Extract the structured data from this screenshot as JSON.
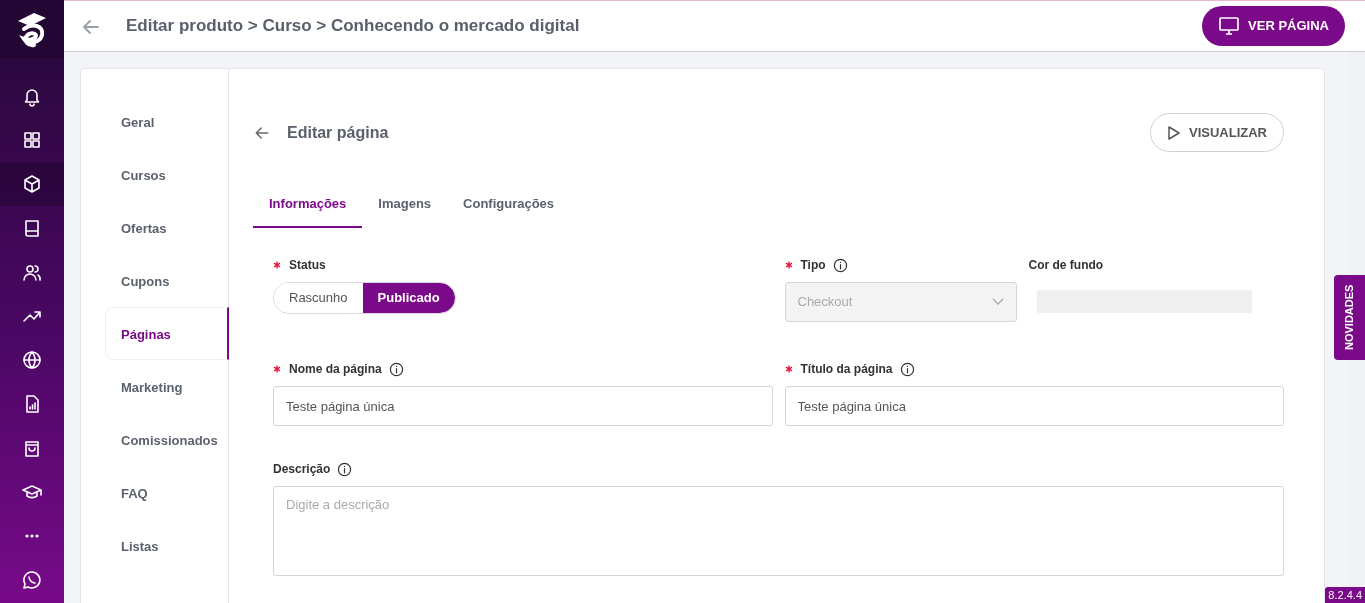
{
  "app_sidebar": {
    "items": [
      {
        "kind": "bell",
        "selected": false
      },
      {
        "kind": "grid",
        "selected": false
      },
      {
        "kind": "cube",
        "selected": true
      },
      {
        "kind": "book",
        "selected": false
      },
      {
        "kind": "users",
        "selected": false
      },
      {
        "kind": "trend",
        "selected": false
      },
      {
        "kind": "globe",
        "selected": false
      },
      {
        "kind": "report",
        "selected": false
      },
      {
        "kind": "bag",
        "selected": false
      },
      {
        "kind": "cap",
        "selected": false
      },
      {
        "kind": "dots",
        "selected": false
      },
      {
        "kind": "chat",
        "selected": false
      }
    ]
  },
  "header": {
    "breadcrumb": "Editar produto > Curso > Conhecendo o mercado digital",
    "button": "VER PÁGINA"
  },
  "product_nav": {
    "items": [
      {
        "label": "Geral",
        "selected": false
      },
      {
        "label": "Cursos",
        "selected": false
      },
      {
        "label": "Ofertas",
        "selected": false
      },
      {
        "label": "Cupons",
        "selected": false
      },
      {
        "label": "Páginas",
        "selected": true
      },
      {
        "label": "Marketing",
        "selected": false
      },
      {
        "label": "Comissionados",
        "selected": false
      },
      {
        "label": "FAQ",
        "selected": false
      },
      {
        "label": "Listas",
        "selected": false
      }
    ]
  },
  "page": {
    "title": "Editar página",
    "button": "VISUALIZAR"
  },
  "tabs": [
    {
      "label": "Informações",
      "selected": true
    },
    {
      "label": "Imagens",
      "selected": false
    },
    {
      "label": "Configurações",
      "selected": false
    }
  ],
  "form": {
    "status": {
      "label": "Status",
      "required": true,
      "options": [
        {
          "label": "Rascunho",
          "selected": false
        },
        {
          "label": "Publicado",
          "selected": true
        }
      ]
    },
    "tipo": {
      "label": "Tipo",
      "required": true,
      "info": true,
      "value": "Checkout",
      "disabled": true
    },
    "cor_de_fundo": {
      "label": "Cor de fundo",
      "required": false
    },
    "nome": {
      "label": "Nome da página",
      "required": true,
      "info": true,
      "value": "Teste página única"
    },
    "titulo": {
      "label": "Título da página",
      "required": true,
      "info": true,
      "value": "Teste página única"
    },
    "descricao": {
      "label": "Descrição",
      "required": false,
      "info": true,
      "placeholder": "Digite a descrição"
    }
  },
  "news_tab": "NOVIDADES",
  "version": "8.2.4.4"
}
